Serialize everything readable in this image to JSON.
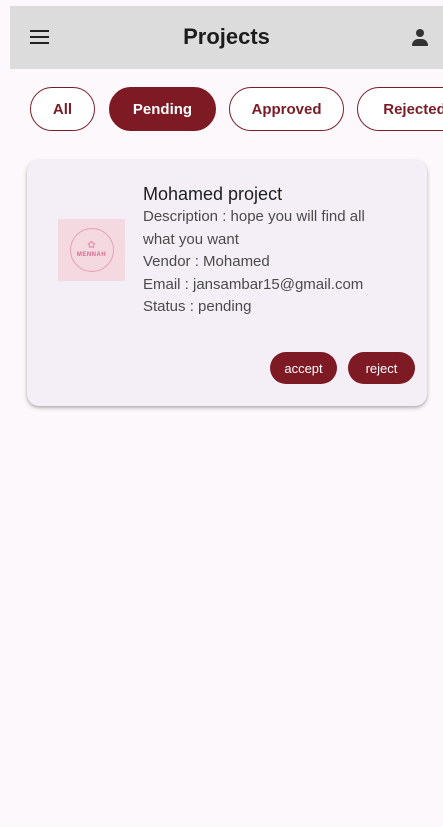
{
  "appbar": {
    "title": "Projects",
    "menu_icon": "hamburger-menu-icon",
    "profile_icon": "person-icon",
    "background": "#dcdcdc"
  },
  "filters": {
    "selected": "Pending",
    "chips": [
      {
        "label": "All"
      },
      {
        "label": "Pending"
      },
      {
        "label": "Approved"
      },
      {
        "label": "Rejected"
      }
    ]
  },
  "project": {
    "logo_text": "MENNAH",
    "name": "Mohamed project",
    "description_line1": "Description : hope you will find all",
    "description_line2": "what you want",
    "vendor": "Vendor : Mohamed",
    "email": "Email : jansambar15@gmail.com",
    "status": "Status : pending",
    "accept_label": "accept",
    "reject_label": "reject"
  },
  "colors": {
    "accent": "#7d1a24",
    "card_background": "#f4eff6",
    "page_background": "#fcf8fb"
  }
}
